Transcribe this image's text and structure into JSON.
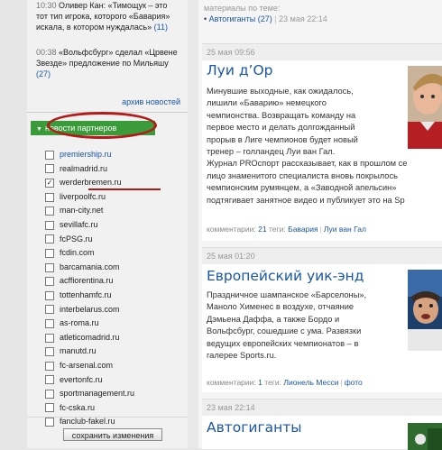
{
  "sidebar": {
    "news": [
      {
        "time": "10:30",
        "text_l1": "Оливер Кан: «Тимощук – это",
        "text_l2": "тот тип игрока, которого «Бавария»",
        "text_l3": "искала, в котором нуждалась»",
        "count": "(11)"
      },
      {
        "time": "00:38",
        "text_l1": "«Вольфсбург» сделал «Црвене",
        "text_l2": "Звезде» предложение по Мильяшу",
        "count": "(27)"
      }
    ],
    "archive_label": "архив новостей",
    "partners_title": "новости партнеров",
    "partners": [
      {
        "name": "premiership.ru",
        "checked": false
      },
      {
        "name": "realmadrid.ru",
        "checked": false
      },
      {
        "name": "werderbremen.ru",
        "checked": true
      },
      {
        "name": "liverpoolfc.ru",
        "checked": false
      },
      {
        "name": "man-city.net",
        "checked": false
      },
      {
        "name": "sevillafc.ru",
        "checked": false
      },
      {
        "name": "fcPSG.ru",
        "checked": false
      },
      {
        "name": "fcdin.com",
        "checked": false
      },
      {
        "name": "barcamania.com",
        "checked": false
      },
      {
        "name": "acffiorentina.ru",
        "checked": false
      },
      {
        "name": "tottenhamfc.ru",
        "checked": false
      },
      {
        "name": "interbelarus.com",
        "checked": false
      },
      {
        "name": "as-roma.ru",
        "checked": false
      },
      {
        "name": "atleticomadrid.ru",
        "checked": false
      },
      {
        "name": "manutd.ru",
        "checked": false
      },
      {
        "name": "fc-arsenal.com",
        "checked": false
      },
      {
        "name": "evertonfc.ru",
        "checked": false
      },
      {
        "name": "sportmanagement.ru",
        "checked": false
      },
      {
        "name": "fc-cska.ru",
        "checked": false
      },
      {
        "name": "fanclub-fakel.ru",
        "checked": false
      }
    ],
    "save_label": "сохранить изменения"
  },
  "related": {
    "label": "материалы по теме:",
    "link": "Автогиганты",
    "count": "(27)",
    "sep": "|",
    "date": "23 мая 22:14"
  },
  "articles": [
    {
      "date": "25 мая 09:56",
      "title": "Луи д’Ор",
      "lines": [
        "Минувшие выходные, как ожидалось,",
        "лишили «Баварию» немецкого",
        "чемпионства. Возвращать команду на",
        "первое место и делать долгожданный",
        "прорыв в Лиге чемпионов будет новый",
        "тренер – голландец Луи ван Гал.",
        "Журнал PROспорт рассказывает, как в прошлом се",
        "лицо знаменитого специалиста вновь покрылось",
        "чемпионским румянцем, а «Заводной апельсин»",
        "подтягивает занятное видео и публикует это на Sp"
      ],
      "comments_label": "комментарии:",
      "comments_count": "21",
      "tags_label": "теги:",
      "tags": [
        "Бавария",
        "Луи ван Гал"
      ]
    },
    {
      "date": "25 мая 01:20",
      "title": "Европейский уик-энд",
      "lines": [
        "Праздничное шампанское «Барселоны»,",
        "Маноло Хименес в воздухе, отчаяние",
        "Дэмьена Даффа, а также Бордо и",
        "Вольфсбург, сошедшие с ума. Развязки",
        "ведущих европейских чемпионатов – в",
        "галерее Sports.ru."
      ],
      "comments_label": "комментарии:",
      "comments_count": "1",
      "tags_label": "теги:",
      "tags": [
        "Лионель Месси",
        "фото"
      ]
    },
    {
      "date": "23 мая 22:14",
      "title": "Автогиганты"
    }
  ],
  "colors": {
    "accent": "#1a56a6",
    "partners_green": "#3b9b3b",
    "annotation_red": "#b31a1a"
  }
}
